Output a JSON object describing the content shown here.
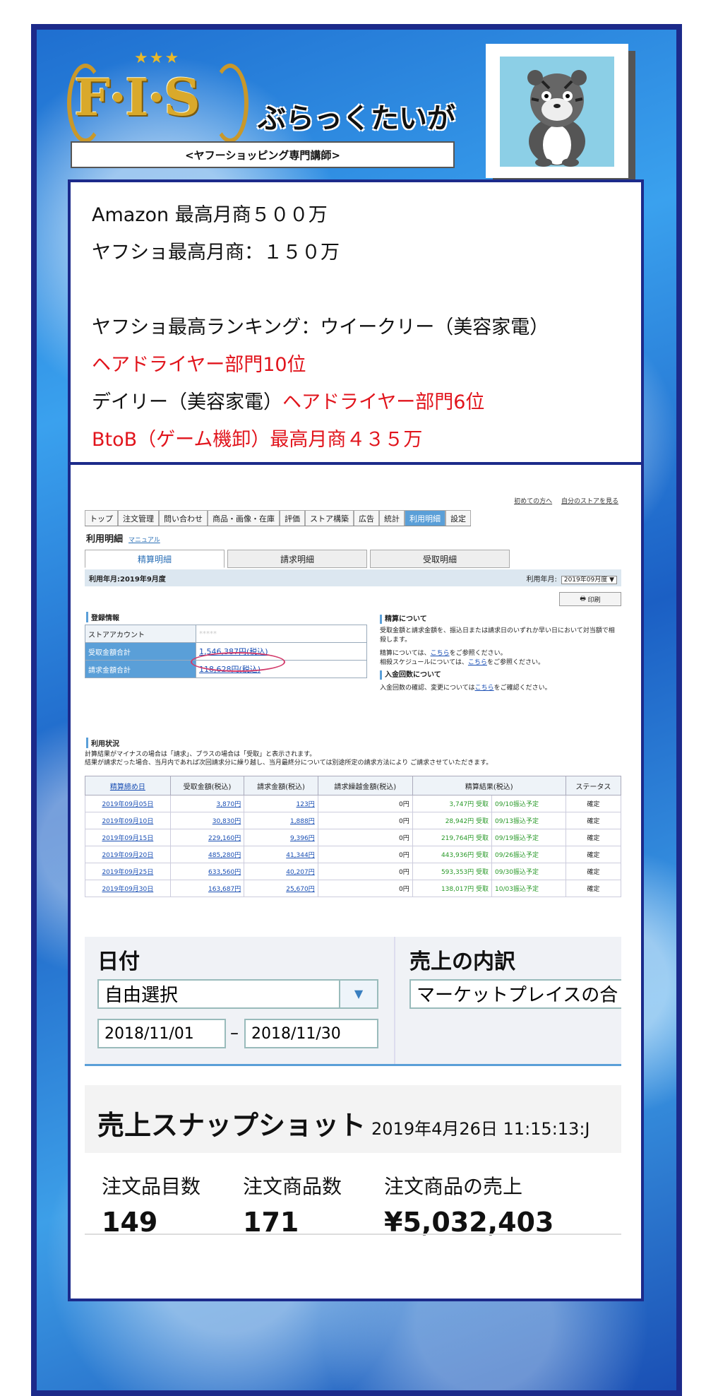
{
  "header": {
    "logo_text": "F·I·S",
    "name": "ぶらっくたいが",
    "subtitle": "<ヤフーショッピング専門講師>"
  },
  "achievements": [
    {
      "text": "Amazon 最高月商５００万",
      "color": "black"
    },
    {
      "text": "ヤフショ最高月商：１５０万",
      "color": "black"
    },
    {
      "text": "",
      "color": "black"
    },
    {
      "text": "ヤフショ最高ランキング：ウイークリー（美容家電）",
      "color": "black"
    },
    {
      "text": "ヘアドライヤー部門10位",
      "color": "red"
    },
    {
      "text_black": "デイリー（美容家電）",
      "text_red": "ヘアドライヤー部門6位"
    },
    {
      "text": "BtoB（ゲーム機卸）最高月商４３５万",
      "color": "red"
    }
  ],
  "yahoo": {
    "top_links": [
      "初めての方へ",
      "自分のストアを見る"
    ],
    "nav": [
      "トップ",
      "注文管理",
      "問い合わせ",
      "商品・画像・在庫",
      "評価",
      "ストア構築",
      "広告",
      "統計",
      "利用明細",
      "設定"
    ],
    "page_title": "利用明細",
    "manual": "マニュアル",
    "tabs": [
      "精算明細",
      "請求明細",
      "受取明細"
    ],
    "period_label": "利用年月:2019年9月度",
    "period_select_label": "利用年月:",
    "period_select": "2019年09月度",
    "print": "印刷",
    "reg_heading": "登録情報",
    "reg_rows": [
      {
        "label": "ストアアカウント",
        "value": "*****"
      },
      {
        "label": "受取金額合計",
        "value": "1,546,387円(税込)"
      },
      {
        "label": "請求金額合計",
        "value": "118,628円(税込)"
      }
    ],
    "side": {
      "h1": "精算について",
      "p1": "受取金額と請求金額を、振込日または請求日のいずれか早い日において対当額で相殺します。",
      "p2a": "精算については、",
      "p2b": "をご参照ください。",
      "p3a": "相殺スケジュールについては、",
      "p3b": "をご参照ください。",
      "link": "こちら",
      "h2": "入金回数について",
      "p4a": "入金回数の確認、変更については",
      "p4b": "をご確認ください。"
    },
    "usage_heading": "利用状況",
    "usage_note1": "計算結果がマイナスの場合は「請求」、プラスの場合は「受取」と表示されます。",
    "usage_note2": "結果が請求だった場合、当月内であれば次回請求分に繰り越し、当月最終分については別途所定の請求方法により ご請求させていただきます。",
    "columns": [
      "精算締め日",
      "受取金額(税込)",
      "請求金額(税込)",
      "請求繰越金額(税込)",
      "精算結果(税込)",
      "ステータス"
    ],
    "rows": [
      [
        "2019年09月05日",
        "3,870円",
        "123円",
        "0円",
        "3,747円 受取",
        "09/10振込予定",
        "確定"
      ],
      [
        "2019年09月10日",
        "30,830円",
        "1,888円",
        "0円",
        "28,942円 受取",
        "09/13振込予定",
        "確定"
      ],
      [
        "2019年09月15日",
        "229,160円",
        "9,396円",
        "0円",
        "219,764円 受取",
        "09/19振込予定",
        "確定"
      ],
      [
        "2019年09月20日",
        "485,280円",
        "41,344円",
        "0円",
        "443,936円 受取",
        "09/26振込予定",
        "確定"
      ],
      [
        "2019年09月25日",
        "633,560円",
        "40,207円",
        "0円",
        "593,353円 受取",
        "09/30振込予定",
        "確定"
      ],
      [
        "2019年09月30日",
        "163,687円",
        "25,670円",
        "0円",
        "138,017円 受取",
        "10/03振込予定",
        "確定"
      ]
    ]
  },
  "amazon": {
    "date_label": "日付",
    "breakdown_label": "売上の内訳",
    "date_select": "自由選択",
    "breakdown_select": "マーケットプレイスの合",
    "date_from": "2018/11/01",
    "date_to": "2018/11/30",
    "dash": "–",
    "snapshot_title": "売上スナップショット",
    "snapshot_time": "2019年4月26日 11:15:13:J",
    "metrics": [
      {
        "label": "注文品目数",
        "value": "149"
      },
      {
        "label": "注文商品数",
        "value": "171"
      },
      {
        "label": "注文商品の売上",
        "value": "¥5,032,403"
      }
    ]
  }
}
